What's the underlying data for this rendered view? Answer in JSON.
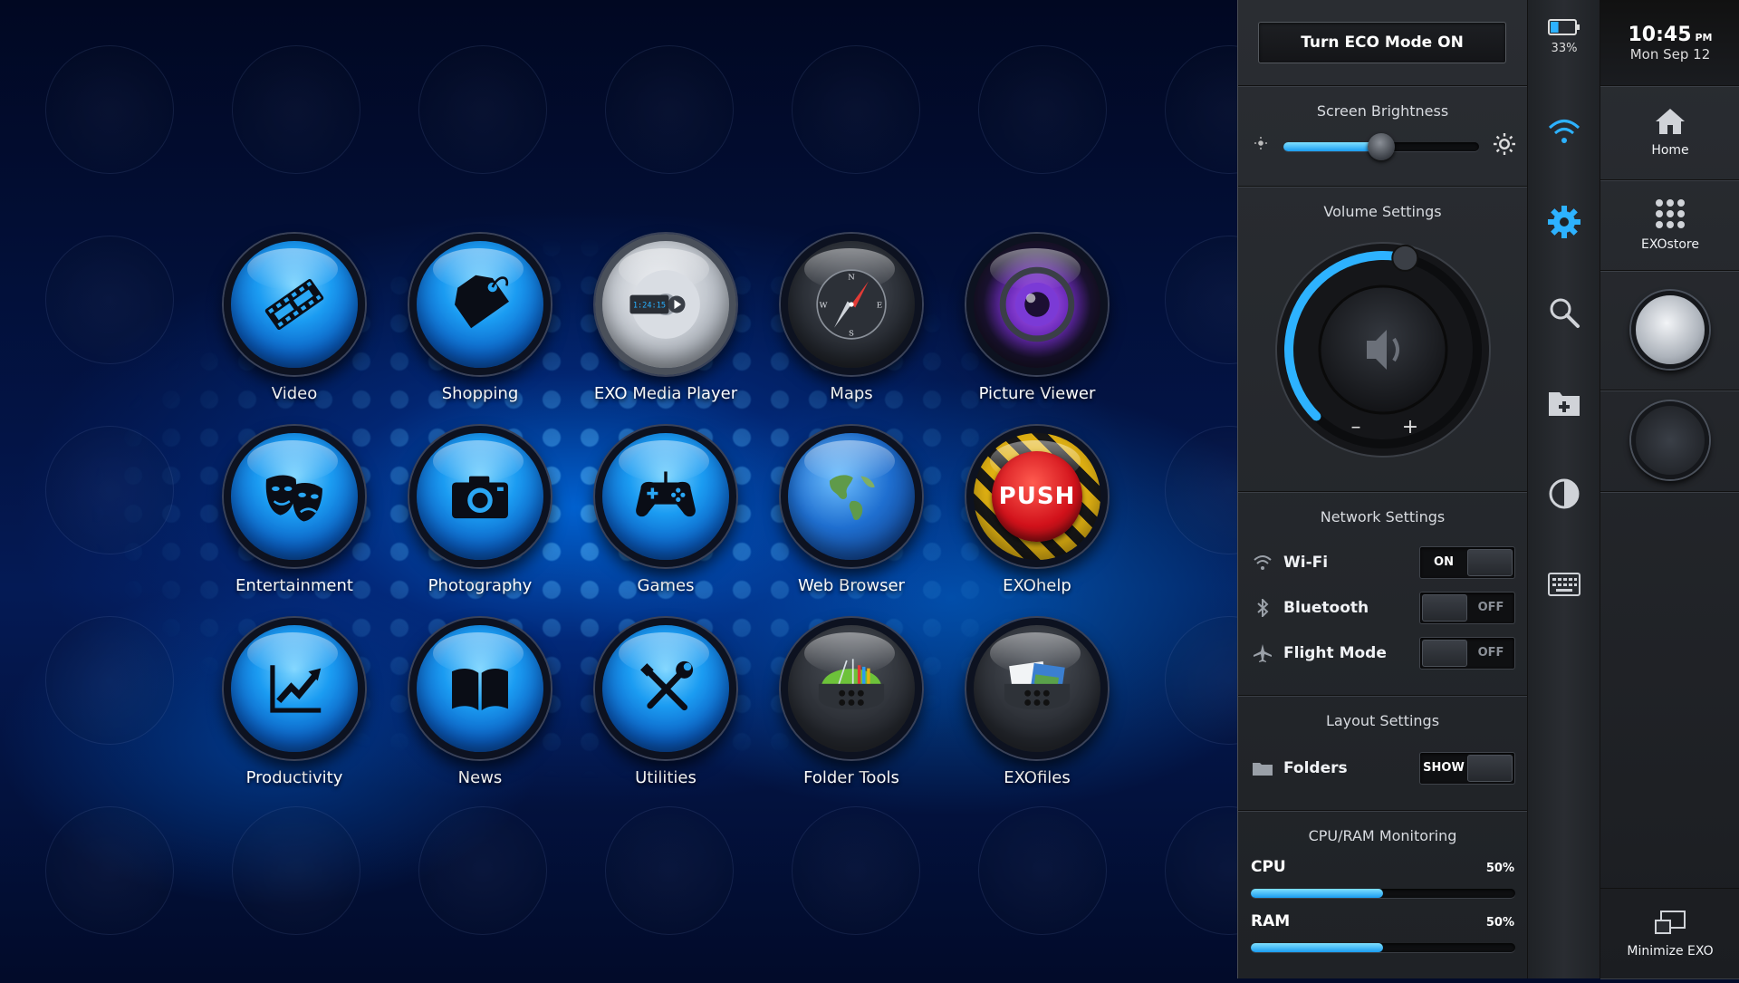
{
  "apps": [
    {
      "label": "Video",
      "icon": "film-icon"
    },
    {
      "label": "Shopping",
      "icon": "tag-icon"
    },
    {
      "label": "EXO Media Player",
      "icon": "media-player-icon",
      "display_text": "1:24:15"
    },
    {
      "label": "Maps",
      "icon": "compass-icon",
      "compass": [
        "N",
        "E",
        "S",
        "W"
      ]
    },
    {
      "label": "Picture Viewer",
      "icon": "camera-lens-icon"
    },
    {
      "label": "Entertainment",
      "icon": "theater-masks-icon"
    },
    {
      "label": "Photography",
      "icon": "camera-icon"
    },
    {
      "label": "Games",
      "icon": "gamepad-icon"
    },
    {
      "label": "Web Browser",
      "icon": "globe-icon"
    },
    {
      "label": "EXOhelp",
      "icon": "push-button-icon",
      "button_text": "PUSH"
    },
    {
      "label": "Productivity",
      "icon": "chart-arrow-icon"
    },
    {
      "label": "News",
      "icon": "book-icon"
    },
    {
      "label": "Utilities",
      "icon": "tools-icon"
    },
    {
      "label": "Folder Tools",
      "icon": "folder-tools-icon"
    },
    {
      "label": "EXOfiles",
      "icon": "folder-files-icon"
    }
  ],
  "settings": {
    "eco_button": "Turn ECO Mode ON",
    "brightness": {
      "title": "Screen Brightness",
      "value": 0.5
    },
    "volume": {
      "title": "Volume Settings",
      "minus": "–",
      "plus": "+",
      "value": 0.55
    },
    "network": {
      "title": "Network Settings",
      "items": [
        {
          "label": "Wi-Fi",
          "state": "ON",
          "icon": "wifi-icon"
        },
        {
          "label": "Bluetooth",
          "state": "OFF",
          "icon": "bluetooth-icon"
        },
        {
          "label": "Flight Mode",
          "state": "OFF",
          "icon": "airplane-icon"
        }
      ]
    },
    "layout": {
      "title": "Layout Settings",
      "items": [
        {
          "label": "Folders",
          "state": "SHOW",
          "icon": "folder-icon"
        }
      ]
    },
    "monitor": {
      "title": "CPU/RAM Monitoring",
      "items": [
        {
          "label": "CPU",
          "percent": "50%",
          "value": 0.5
        },
        {
          "label": "RAM",
          "percent": "50%",
          "value": 0.5
        }
      ]
    }
  },
  "toolstrip": {
    "battery": "33%",
    "battery_level": 0.33,
    "tools": [
      "wifi-icon",
      "gear-icon",
      "search-icon",
      "new-folder-icon",
      "contrast-icon",
      "keyboard-icon"
    ]
  },
  "dock": {
    "time": "10:45",
    "ampm": "PM",
    "date": "Mon Sep 12",
    "home": "Home",
    "store": "EXOstore",
    "minimize": "Minimize EXO"
  },
  "colors": {
    "accent": "#1a9cf0",
    "panel": "#25282d",
    "push": "#d2121b"
  }
}
